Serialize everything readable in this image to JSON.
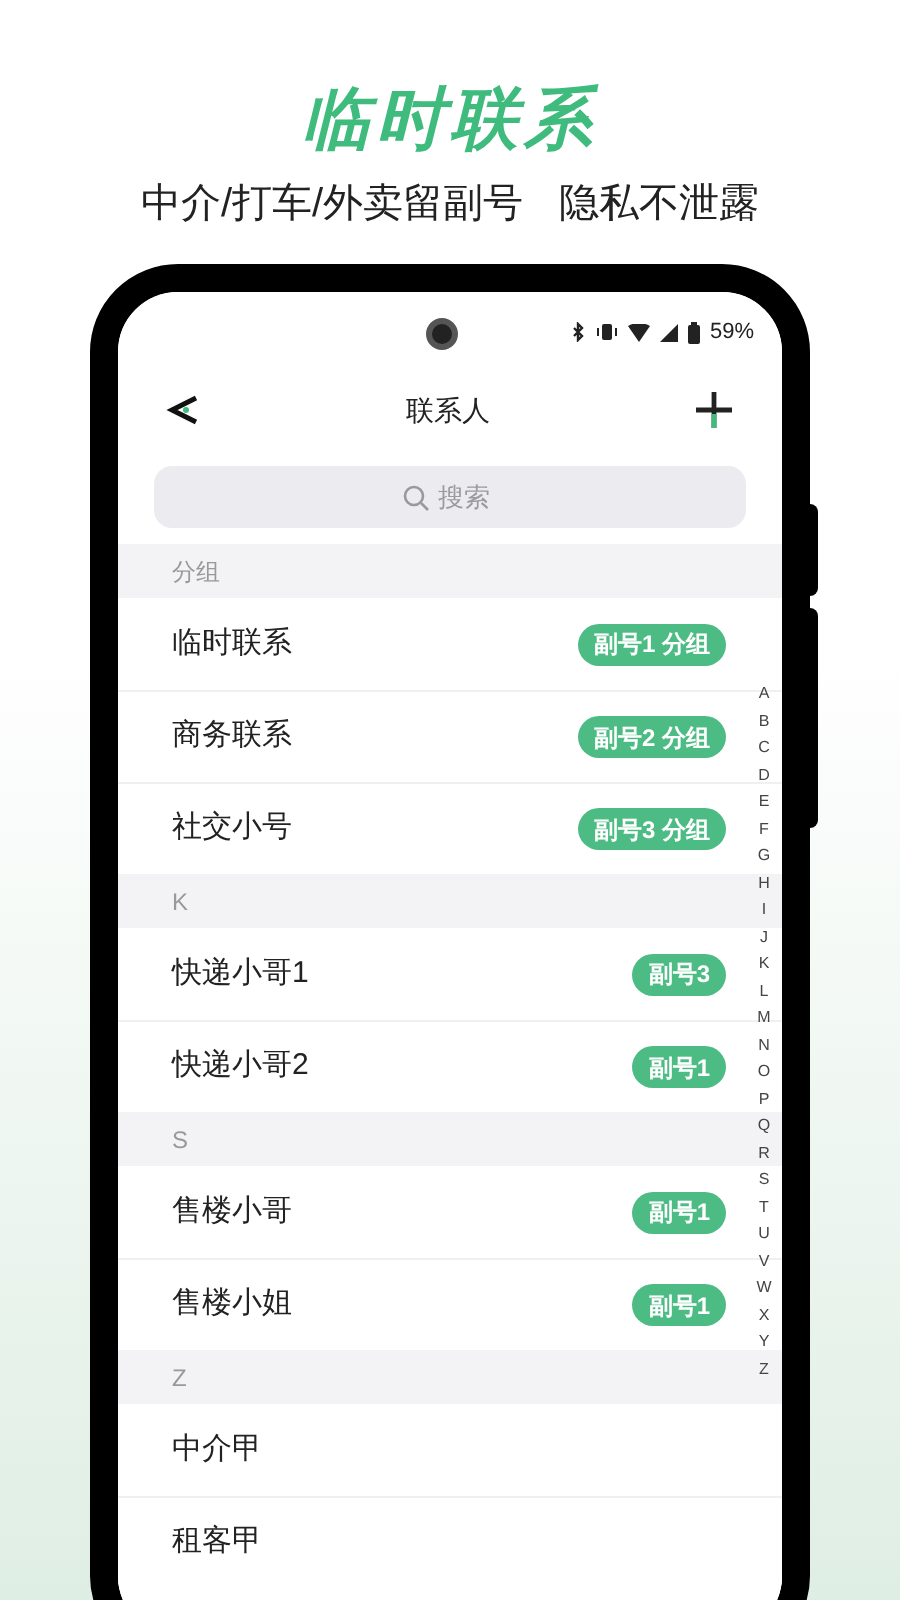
{
  "headline": "临时联系",
  "subtitles": [
    "中介/打车/外卖留副号",
    "隐私不泄露"
  ],
  "status_bar": {
    "battery": "59%"
  },
  "nav": {
    "title": "联系人"
  },
  "search": {
    "placeholder": "搜索"
  },
  "sections": [
    {
      "header": "分组",
      "rows": [
        {
          "name": "临时联系",
          "badge": "副号1 分组"
        },
        {
          "name": "商务联系",
          "badge": "副号2 分组"
        },
        {
          "name": "社交小号",
          "badge": "副号3 分组"
        }
      ]
    },
    {
      "header": "K",
      "rows": [
        {
          "name": "快递小哥1",
          "badge": "副号3"
        },
        {
          "name": "快递小哥2",
          "badge": "副号1"
        }
      ]
    },
    {
      "header": "S",
      "rows": [
        {
          "name": "售楼小哥",
          "badge": "副号1"
        },
        {
          "name": "售楼小姐",
          "badge": "副号1"
        }
      ]
    },
    {
      "header": "Z",
      "rows": [
        {
          "name": "中介甲"
        },
        {
          "name": "租客甲"
        }
      ]
    }
  ],
  "index": [
    "A",
    "B",
    "C",
    "D",
    "E",
    "F",
    "G",
    "H",
    "I",
    "J",
    "K",
    "L",
    "M",
    "N",
    "O",
    "P",
    "Q",
    "R",
    "S",
    "T",
    "U",
    "V",
    "W",
    "X",
    "Y",
    "Z"
  ]
}
